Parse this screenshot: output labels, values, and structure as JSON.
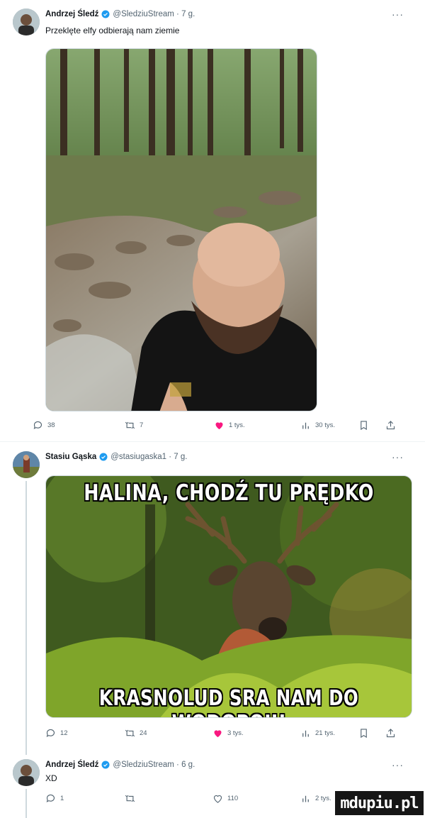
{
  "tweets": [
    {
      "name": "Andrzej Śledź",
      "handle": "@SledziuStream · 7 g.",
      "more": "···",
      "text": "Przeklęte elfy odbierają nam ziemie",
      "actions": {
        "replies": "38",
        "retweets": "7",
        "likes": "1 tys.",
        "views": "30 tys."
      }
    },
    {
      "name": "Stasiu Gąska",
      "handle": "@stasiugaska1 · 7 g.",
      "more": "···",
      "meme": {
        "top": "HALINA, CHODŹ TU PRĘDKO",
        "bottom": "KRASNOLUD SRA NAM DO WODOPOJU"
      },
      "actions": {
        "replies": "12",
        "retweets": "24",
        "likes": "3 tys.",
        "views": "21 tys."
      }
    },
    {
      "name": "Andrzej Śledź",
      "handle": "@SledziuStream · 6 g.",
      "more": "···",
      "text": "XD",
      "actions": {
        "replies": "1",
        "retweets": "",
        "likes": "110",
        "views": "2 tys."
      }
    }
  ],
  "watermark": "mdupiu.pl",
  "colors": {
    "verified": "#1d9bf0",
    "like": "#f91880",
    "muted": "#536471"
  }
}
